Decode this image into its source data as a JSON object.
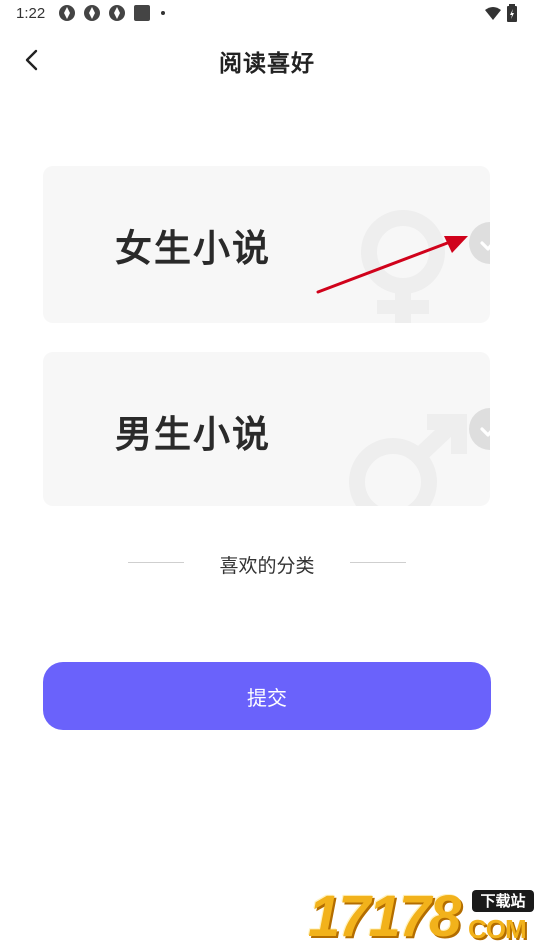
{
  "status_bar": {
    "time": "1:22",
    "icons": [
      "app-notification-icon",
      "app-notification-icon",
      "app-notification-icon",
      "square-notification-icon",
      "more-dot-icon",
      "wifi-icon",
      "battery-icon"
    ]
  },
  "header": {
    "title": "阅读喜好",
    "back_icon": "chevron-left-icon"
  },
  "options": [
    {
      "label": "女生小说",
      "icon": "female-symbol-icon",
      "selected": false
    },
    {
      "label": "男生小说",
      "icon": "male-symbol-icon",
      "selected": false
    }
  ],
  "divider": {
    "label": "喜欢的分类"
  },
  "submit": {
    "label": "提交"
  },
  "watermark": {
    "number": "17178",
    "badge": "下载站",
    "domain": "COM"
  },
  "colors": {
    "accent": "#6a62fb",
    "card_bg": "#f7f7f7",
    "check_bg": "#dedede",
    "annotation_arrow": "#d0021b"
  }
}
